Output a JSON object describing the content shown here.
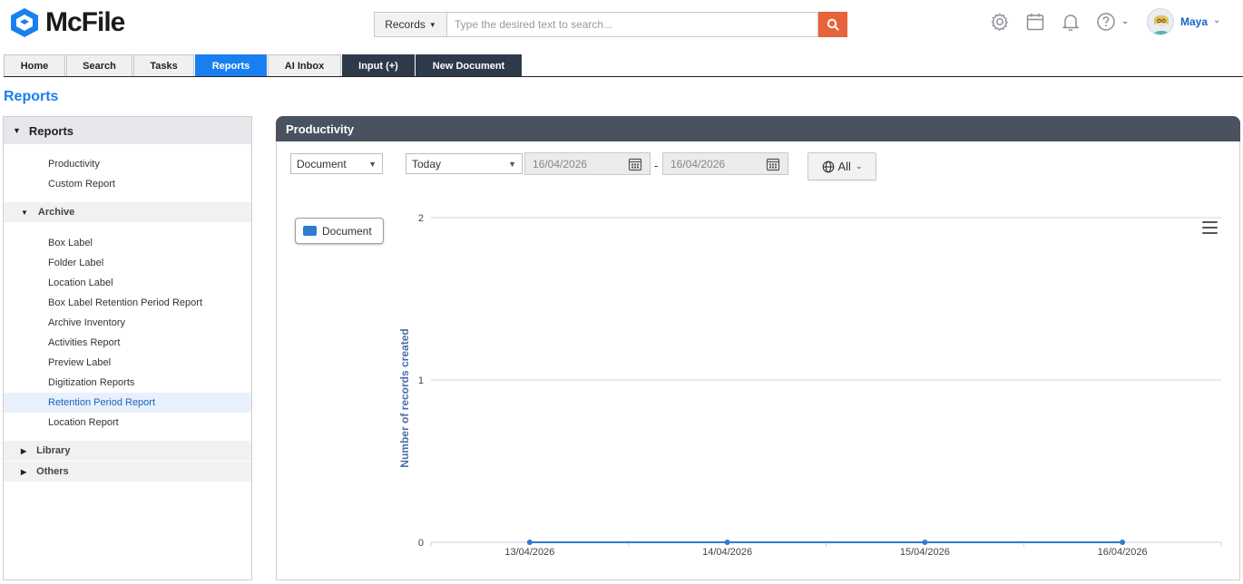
{
  "brand": {
    "name": "McFile"
  },
  "search": {
    "scope_label": "Records",
    "placeholder": "Type the desired text to search..."
  },
  "user": {
    "name": "Maya"
  },
  "header_icons": [
    "gear-icon",
    "calendar-icon",
    "bell-icon",
    "help-icon"
  ],
  "tabs": [
    {
      "label": "Home"
    },
    {
      "label": "Search"
    },
    {
      "label": "Tasks"
    },
    {
      "label": "Reports"
    },
    {
      "label": "AI Inbox"
    },
    {
      "label": "Input (+)"
    },
    {
      "label": "New Document"
    }
  ],
  "page_title": "Reports",
  "sidebar": {
    "header": "Reports",
    "top_items": [
      "Productivity",
      "Custom Report"
    ],
    "archive": {
      "label": "Archive",
      "items": [
        "Box Label",
        "Folder Label",
        "Location Label",
        "Box Label Retention Period Report",
        "Archive Inventory",
        "Activities Report",
        "Preview Label",
        "Digitization Reports",
        "Retention Period Report",
        "Location Report"
      ]
    },
    "library_label": "Library",
    "others_label": "Others",
    "selected_item": "Retention Period Report"
  },
  "panel": {
    "title": "Productivity",
    "type_select": "Document",
    "range_select": "Today",
    "date_from": "16/04/2026",
    "date_to": "16/04/2026",
    "date_separator": "-",
    "filter_label": "All"
  },
  "accent_colors": {
    "primary": "#1a7ff0",
    "search_button": "#e8623a",
    "panel_header": "#4a5260",
    "series": "#2e7bd0"
  },
  "chart_data": {
    "type": "line",
    "title": "",
    "xlabel": "",
    "ylabel": "Number of records created",
    "categories": [
      "13/04/2026",
      "14/04/2026",
      "15/04/2026",
      "16/04/2026"
    ],
    "series": [
      {
        "name": "Document",
        "values": [
          0,
          0,
          0,
          0
        ],
        "color": "#2e7bd0"
      }
    ],
    "ylim": [
      0,
      2
    ],
    "yticks": [
      0,
      1,
      2
    ],
    "grid": true,
    "legend": "top-left"
  }
}
